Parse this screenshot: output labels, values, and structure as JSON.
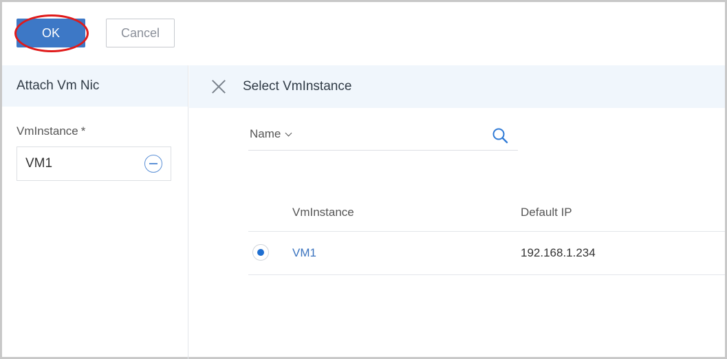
{
  "toolbar": {
    "ok_label": "OK",
    "cancel_label": "Cancel"
  },
  "left_panel": {
    "title": "Attach Vm Nic",
    "field_label": "VmInstance",
    "required_mark": "*",
    "selected_value": "VM1"
  },
  "right_panel": {
    "title": "Select VmInstance",
    "search": {
      "filter_label": "Name",
      "placeholder": "",
      "value": ""
    },
    "table": {
      "columns": [
        "VmInstance",
        "Default IP"
      ],
      "rows": [
        {
          "selected": true,
          "name": "VM1",
          "ip": "192.168.1.234"
        }
      ]
    }
  },
  "colors": {
    "primary": "#3d78c6",
    "highlight_ring": "#e01a1a",
    "header_bg": "#f0f6fc",
    "link": "#3a73bf"
  },
  "icons": [
    "close-icon",
    "search-icon",
    "remove-icon",
    "chevron-down-icon",
    "radio-selected-icon"
  ]
}
